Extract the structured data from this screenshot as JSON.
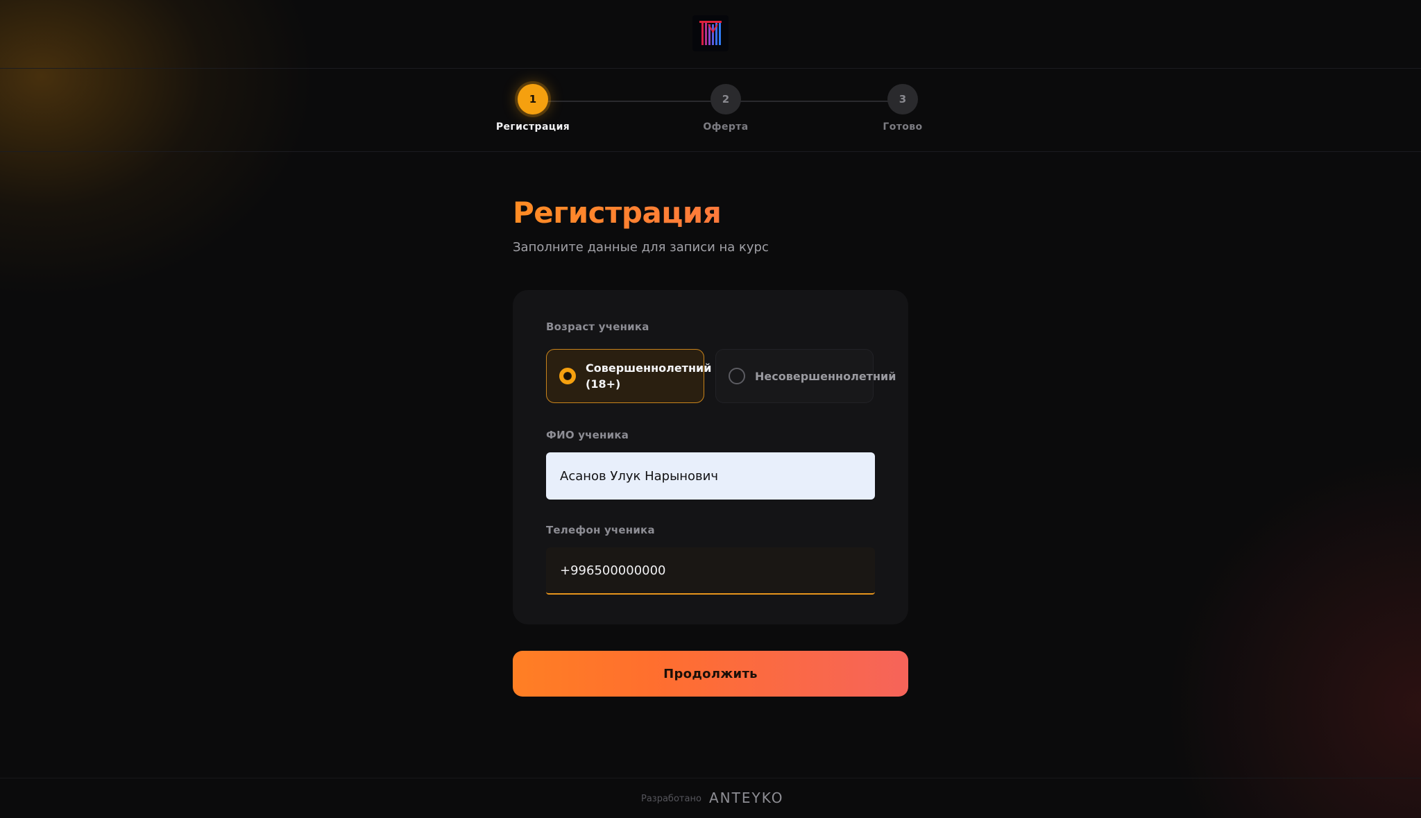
{
  "steps": [
    {
      "number": "1",
      "label": "Регистрация",
      "active": true
    },
    {
      "number": "2",
      "label": "Оферта",
      "active": false
    },
    {
      "number": "3",
      "label": "Готово",
      "active": false
    }
  ],
  "form": {
    "title": "Регистрация",
    "subtitle": "Заполните данные для записи на курс",
    "age_label": "Возраст ученика",
    "age_options": [
      {
        "label": "Совершеннолетний (18+)",
        "selected": true
      },
      {
        "label": "Несовершеннолетний",
        "selected": false
      }
    ],
    "name_label": "ФИО ученика",
    "name_value": "Асанов Улук Нарынович",
    "phone_label": "Телефон ученика",
    "phone_value": "+996500000000",
    "continue_label": "Продолжить"
  },
  "footer": {
    "developed_by": "Разработано",
    "brand": "ANTEYKO"
  },
  "colors": {
    "accent": "#f5a00f",
    "title_gradient_start": "#ff8c24",
    "button_gradient_end": "#f6645a",
    "background": "#0b0b0c"
  },
  "icons": {
    "logo": "school-logo-icon",
    "radio_selected": "radio-selected-icon",
    "radio_unselected": "radio-unselected-icon"
  }
}
